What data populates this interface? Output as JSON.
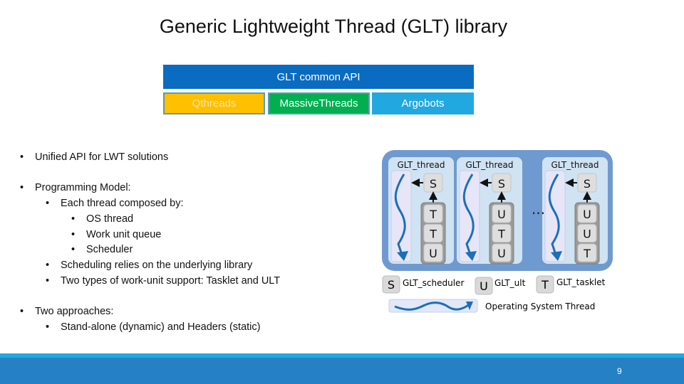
{
  "slide": {
    "title": "Generic Lightweight Thread (GLT) library",
    "page_number": "9"
  },
  "architecture": {
    "api_layer": "GLT common API",
    "libraries": [
      "Qthreads",
      "MassiveThreads",
      "Argobots"
    ]
  },
  "bullets": {
    "b1": "Unified API for LWT solutions",
    "b2": "Programming Model:",
    "b2_1": "Each thread composed by:",
    "b2_1_1": "OS thread",
    "b2_1_2": "Work unit queue",
    "b2_1_3": "Scheduler",
    "b2_2": "Scheduling relies on the underlying library",
    "b2_3": "Two types of work-unit support: Tasklet and ULT",
    "b3": "Two approaches:",
    "b3_1": "Stand-alone (dynamic) and Headers (static)"
  },
  "diagram": {
    "threads": [
      {
        "label": "GLT_thread",
        "scheduler": "S",
        "queue": [
          "T",
          "T",
          "U"
        ]
      },
      {
        "label": "GLT_thread",
        "scheduler": "S",
        "queue": [
          "U",
          "T",
          "U"
        ]
      },
      {
        "label": "GLT_thread",
        "scheduler": "S",
        "queue": [
          "U",
          "U",
          "T"
        ]
      }
    ],
    "ellipsis": "...",
    "legend": {
      "s_key": "S",
      "s_label": "GLT_scheduler",
      "u_key": "U",
      "u_label": "GLT_ult",
      "t_key": "T",
      "t_label": "GLT_tasklet",
      "os_label": "Operating System Thread"
    }
  },
  "colors": {
    "api_blue": "#0a6cc0",
    "qthreads": "#ffc000",
    "massivethreads": "#00b050",
    "argobots": "#22a8e0",
    "footer": "#2680c4"
  }
}
